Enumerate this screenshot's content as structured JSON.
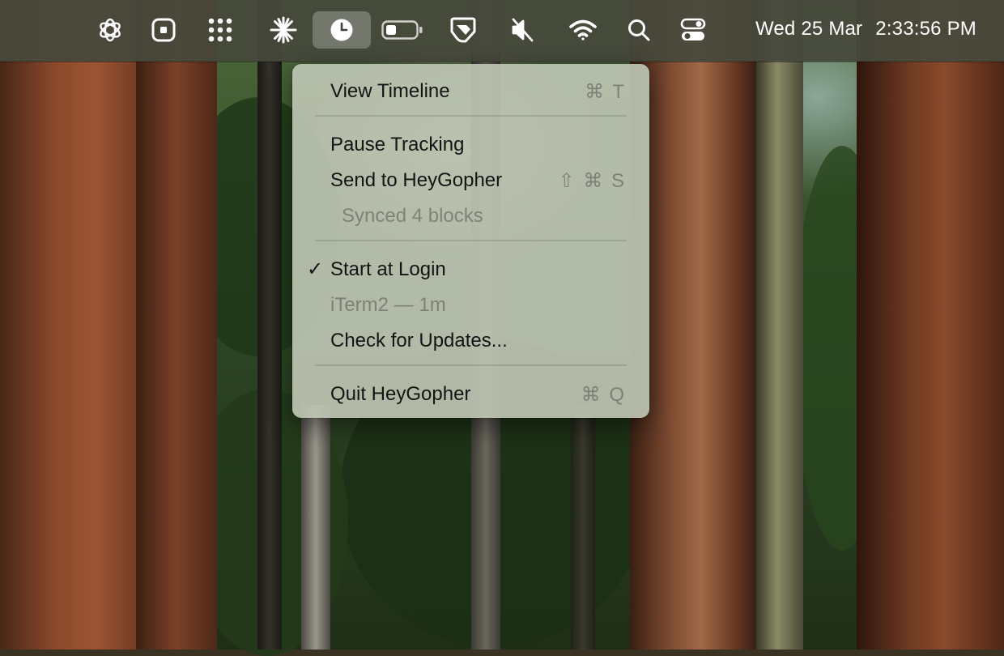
{
  "menubar": {
    "icons": [
      "chatgpt-icon",
      "stop-square-icon",
      "dot-grid-icon",
      "spark-burst-icon",
      "heygopher-clock-icon",
      "battery-icon",
      "notch-app-icon",
      "mute-icon",
      "wifi-icon",
      "search-icon",
      "control-center-icon"
    ],
    "active_icon": "heygopher-clock-icon",
    "date": "Wed 25 Mar",
    "time": "2:33:56 PM"
  },
  "menu": {
    "view_timeline": {
      "label": "View Timeline",
      "shortcut": "⌘ T"
    },
    "pause_tracking": {
      "label": "Pause Tracking"
    },
    "send_to": {
      "label": "Send to HeyGopher",
      "shortcut": "⇧ ⌘ S"
    },
    "synced": {
      "label": "Synced 4 blocks"
    },
    "start_at_login": {
      "label": "Start at Login",
      "checked": true,
      "check_glyph": "✓"
    },
    "current_app": {
      "label": "iTerm2 — 1m"
    },
    "check_updates": {
      "label": "Check for Updates..."
    },
    "quit": {
      "label": "Quit HeyGopher",
      "shortcut": "⌘ Q"
    }
  },
  "colors": {
    "menubar_bg": "#46483c",
    "menu_bg": "#bcc4b2",
    "menu_text": "#141414",
    "disabled_text": "#8f938a"
  }
}
